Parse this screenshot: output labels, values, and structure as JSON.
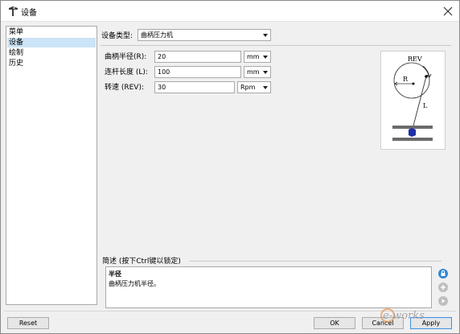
{
  "window": {
    "title": "设备",
    "title_icon": "tool-icon",
    "close_icon": "close-icon"
  },
  "sidebar": {
    "items": [
      {
        "label": "菜单",
        "selected": false
      },
      {
        "label": "设备",
        "selected": true
      },
      {
        "label": "绘制",
        "selected": false
      },
      {
        "label": "历史",
        "selected": false
      }
    ]
  },
  "device": {
    "type_label": "设备类型:",
    "type_value": "曲柄压力机"
  },
  "params": [
    {
      "label": "曲柄半径(R):",
      "value": "20",
      "unit": "mm"
    },
    {
      "label": "连杆长度 (L):",
      "value": "100",
      "unit": "mm"
    },
    {
      "label": "转速 (REV):",
      "value": "30",
      "unit": "Rpm"
    }
  ],
  "diagram": {
    "rev_label": "REV",
    "r_label": "R",
    "l_label": "L"
  },
  "description": {
    "title": "简述 (按下Ctrl键以锁定)",
    "heading": "半径",
    "text": "曲柄压力机半径。"
  },
  "footer": {
    "reset_label": "Reset",
    "ok_label": "OK",
    "cancel_label": "Cancel",
    "apply_label": "Apply"
  },
  "watermark": {
    "text": "e-works"
  },
  "colors": {
    "accent": "#2f86d6",
    "selection": "#cce4f7"
  }
}
